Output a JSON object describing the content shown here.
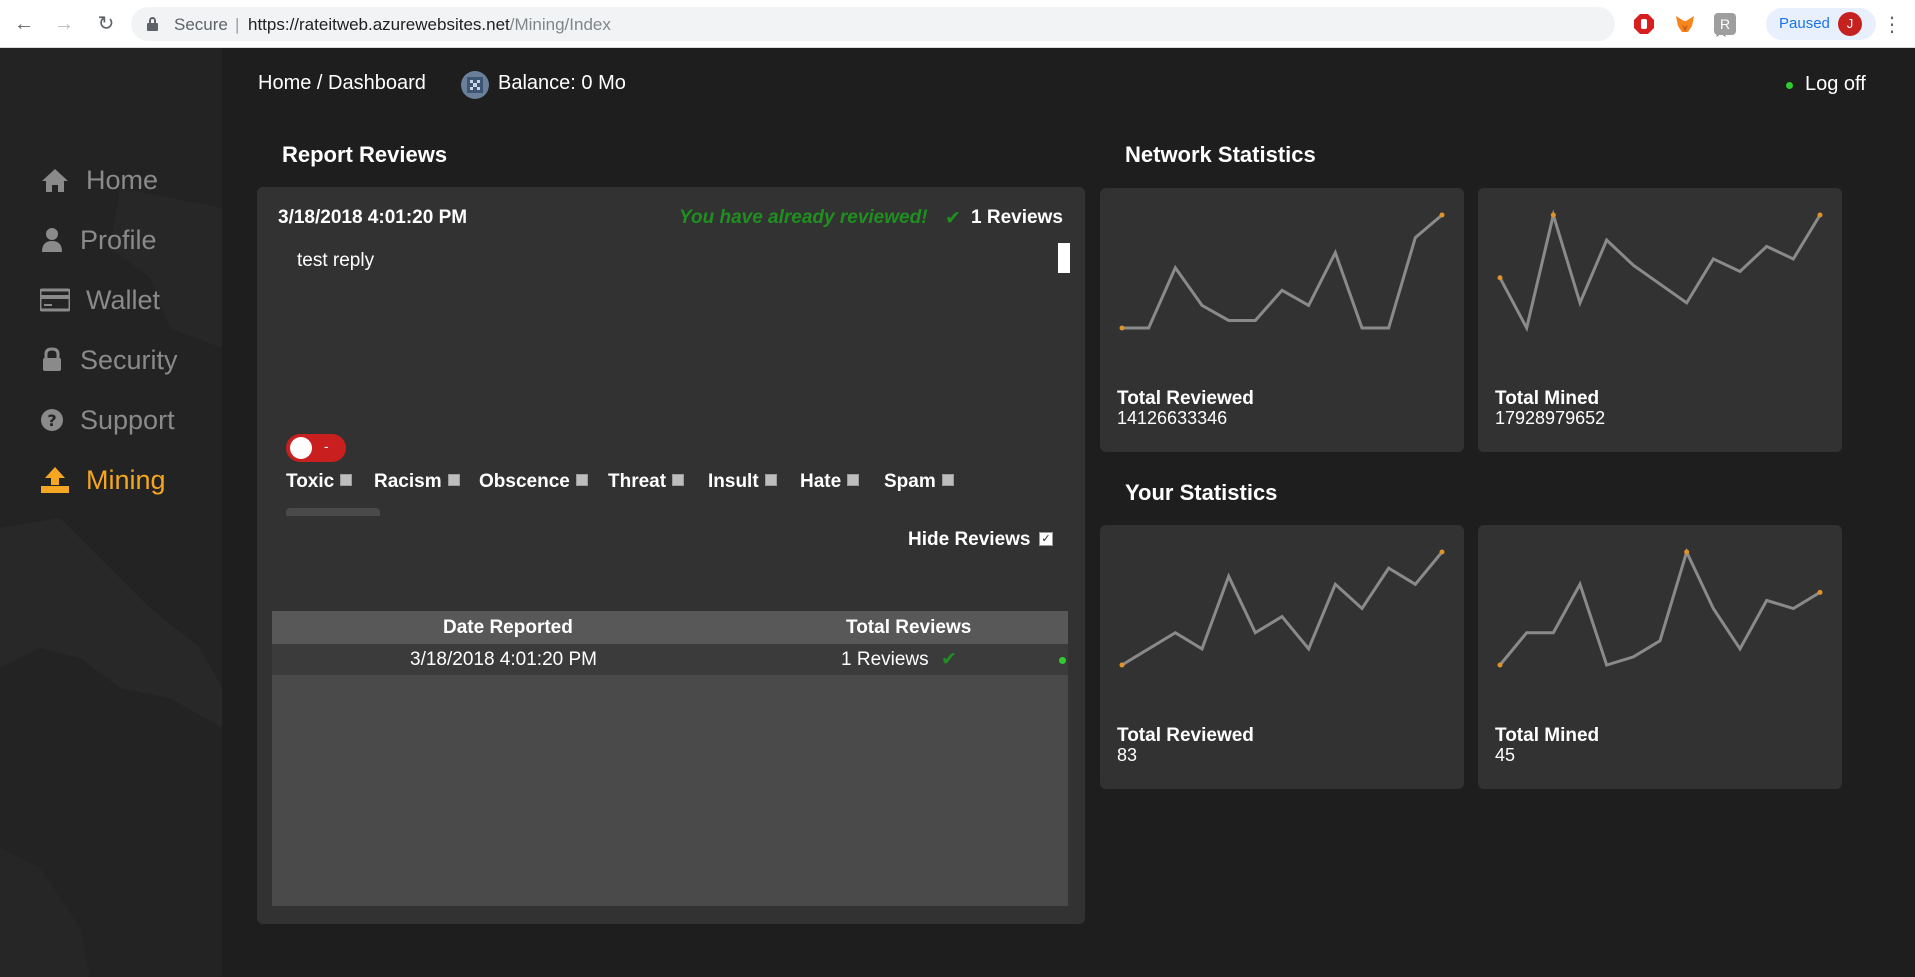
{
  "browser": {
    "secure_label": "Secure",
    "url_host": "https://rateitweb.azurewebsites.net",
    "url_path": "/Mining/Index",
    "paused_label": "Paused",
    "avatar_letter": "J"
  },
  "sidebar": {
    "items": [
      {
        "label": "Home",
        "icon": "home-icon"
      },
      {
        "label": "Profile",
        "icon": "user-icon"
      },
      {
        "label": "Wallet",
        "icon": "credit-card-icon"
      },
      {
        "label": "Security",
        "icon": "lock-icon"
      },
      {
        "label": "Support",
        "icon": "question-circle-icon"
      },
      {
        "label": "Mining",
        "icon": "upload-icon",
        "active": true
      }
    ],
    "active_color": "#f5a623"
  },
  "header": {
    "breadcrumb": "Home / Dashboard",
    "balance": "Balance: 0 Mo",
    "logoff": "Log off"
  },
  "report": {
    "title": "Report Reviews",
    "date": "3/18/2018 4:01:20 PM",
    "reviewed_msg": "You have already reviewed!",
    "reviews_count": "1 Reviews",
    "text": "test reply",
    "toggle_label": "-",
    "categories": [
      "Toxic",
      "Racism",
      "Obscence",
      "Threat",
      "Insult",
      "Hate",
      "Spam"
    ],
    "hide_reviews_label": "Hide Reviews",
    "hide_reviews_checked": true,
    "table": {
      "headers": [
        "Date Reported",
        "Total Reviews"
      ],
      "rows": [
        {
          "date": "3/18/2018 4:01:20 PM",
          "reviews": "1 Reviews",
          "reviewed": true
        }
      ]
    }
  },
  "network": {
    "title": "Network Statistics",
    "cards": [
      {
        "label": "Total Reviewed",
        "value": "14126633346",
        "series": [
          2,
          2,
          10,
          5,
          3,
          3,
          7,
          5,
          12,
          2,
          2,
          14,
          17
        ]
      },
      {
        "label": "Total Mined",
        "value": "17928979652",
        "series": [
          10,
          2,
          20,
          6,
          16,
          12,
          9,
          6,
          13,
          11,
          15,
          13,
          20
        ]
      }
    ]
  },
  "yours": {
    "title": "Your Statistics",
    "cards": [
      {
        "label": "Total Reviewed",
        "value": "83",
        "series": [
          1,
          3,
          5,
          3,
          12,
          5,
          7,
          3,
          11,
          8,
          13,
          11,
          15
        ]
      },
      {
        "label": "Total Mined",
        "value": "45",
        "series": [
          1,
          5,
          5,
          11,
          1,
          2,
          4,
          15,
          8,
          3,
          9,
          8,
          10
        ]
      }
    ]
  },
  "colors": {
    "line": "#8a8a8a",
    "endpoint": "#e0922a",
    "success": "#1f8f1f",
    "danger": "#c9201f"
  }
}
